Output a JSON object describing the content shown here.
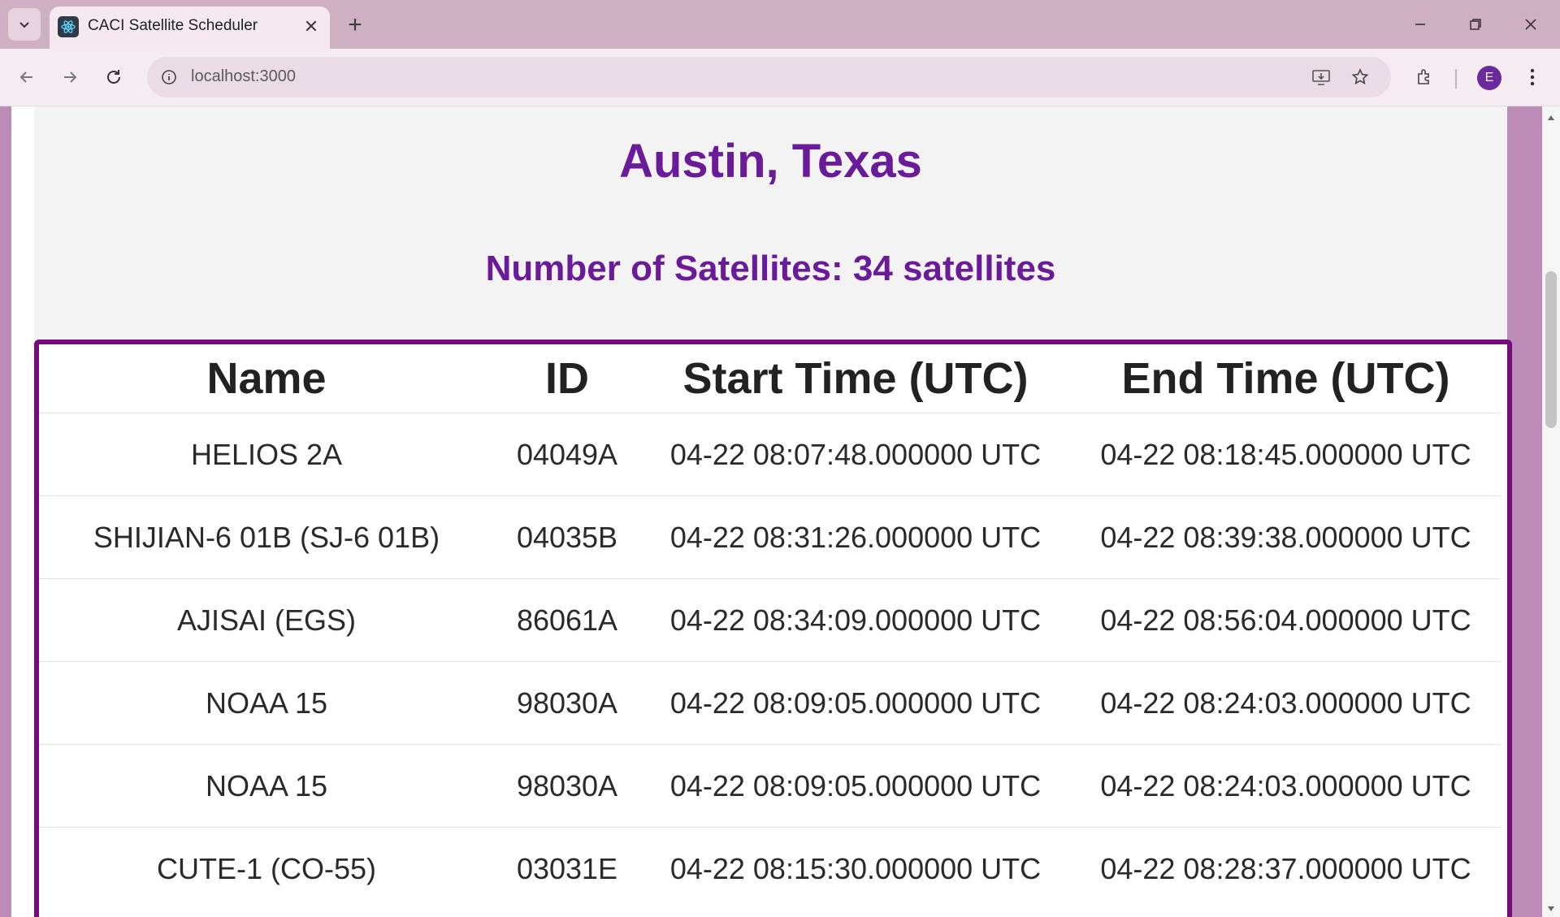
{
  "browser": {
    "tab_title": "CACI Satellite Scheduler",
    "url": "localhost:3000",
    "profile_initial": "E"
  },
  "page": {
    "location": "Austin, Texas",
    "count_label": "Number of Satellites: ",
    "count_value": "34 satellites"
  },
  "table": {
    "headers": [
      "Name",
      "ID",
      "Start Time (UTC)",
      "End Time (UTC)"
    ],
    "rows": [
      {
        "name": "HELIOS 2A",
        "id": "04049A",
        "start": "04-22 08:07:48.000000 UTC",
        "end": "04-22 08:18:45.000000 UTC"
      },
      {
        "name": "SHIJIAN-6 01B (SJ-6 01B)",
        "id": "04035B",
        "start": "04-22 08:31:26.000000 UTC",
        "end": "04-22 08:39:38.000000 UTC"
      },
      {
        "name": "AJISAI (EGS)",
        "id": "86061A",
        "start": "04-22 08:34:09.000000 UTC",
        "end": "04-22 08:56:04.000000 UTC"
      },
      {
        "name": "NOAA 15",
        "id": "98030A",
        "start": "04-22 08:09:05.000000 UTC",
        "end": "04-22 08:24:03.000000 UTC"
      },
      {
        "name": "NOAA 15",
        "id": "98030A",
        "start": "04-22 08:09:05.000000 UTC",
        "end": "04-22 08:24:03.000000 UTC"
      },
      {
        "name": "CUTE-1 (CO-55)",
        "id": "03031E",
        "start": "04-22 08:15:30.000000 UTC",
        "end": "04-22 08:28:37.000000 UTC"
      }
    ]
  },
  "colors": {
    "accent": "#6a1b9a",
    "table_border": "#740a7c",
    "page_bg": "#bd8bb8"
  }
}
